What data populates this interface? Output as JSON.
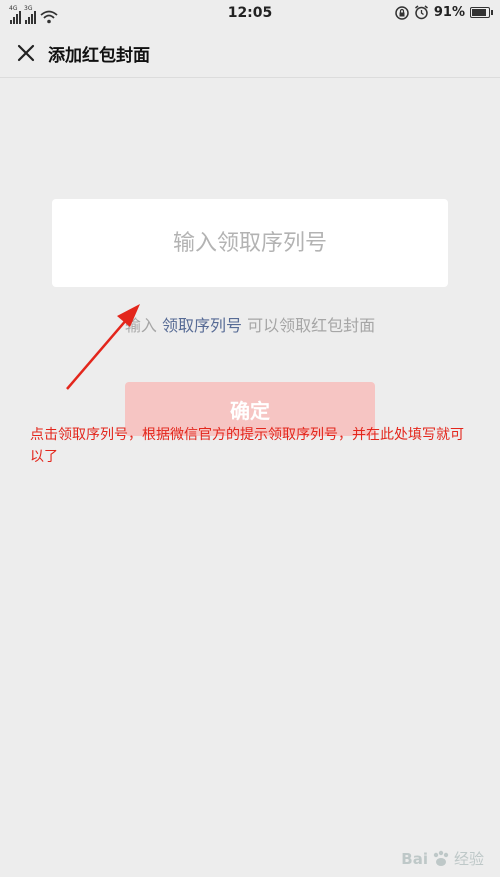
{
  "status_bar": {
    "network_1": "4G",
    "network_2": "3G",
    "time": "12:05",
    "battery_pct": "91%",
    "battery_level": 0.91
  },
  "nav": {
    "title": "添加红包封面"
  },
  "input": {
    "placeholder": "输入领取序列号",
    "value": ""
  },
  "hint": {
    "before": "输入 ",
    "link": "领取序列号",
    "after": " 可以领取红包封面"
  },
  "confirm_label": "确定",
  "annotation": "点击领取序列号，根据微信官方的提示领取序列号，并在此处填写就可以了",
  "watermark": {
    "brand": "Bai",
    "brand_end": "经验"
  },
  "colors": {
    "link": "#576b95",
    "button": "#f6c5c3",
    "annotation": "#e3261c"
  }
}
